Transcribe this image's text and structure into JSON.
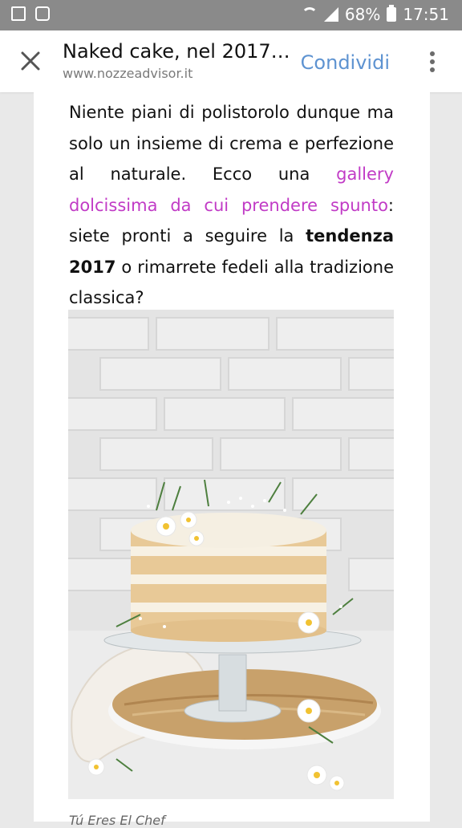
{
  "status_bar": {
    "battery_percent": "68%",
    "time": "17:51",
    "icons": [
      "gallery-icon",
      "recycle-icon",
      "wifi-icon",
      "signal-icon",
      "battery-icon"
    ]
  },
  "app_bar": {
    "title": "Naked cake, nel 2017 l...",
    "url": "www.nozzeadvisor.it",
    "share_label": "Condividi",
    "icons": [
      "close-icon",
      "more-vert-icon"
    ],
    "accent_color": "#5e93d1"
  },
  "article": {
    "p1_part1": "Niente piani di polistorolo dunque ma solo un insieme di crema e perfezione al naturale. Ecco una ",
    "p1_link": "gallery dolcissima da cui prendere spunto",
    "p1_part2": ": siete pronti a seguire la ",
    "p1_bold": "tendenza 2017",
    "p1_part3": " o rimarrete fedeli alla tradizione classica?",
    "link_color": "#c13bc6",
    "caption": "Tú Eres El Chef"
  }
}
